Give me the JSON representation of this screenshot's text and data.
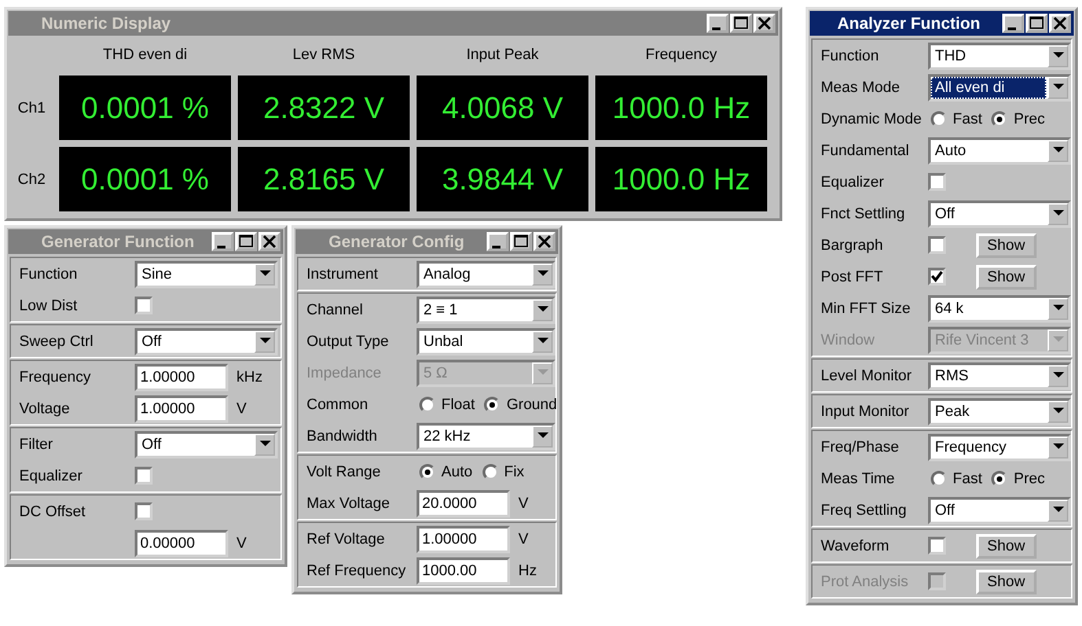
{
  "windows": [
    {
      "kind": "numeric",
      "title": "Numeric Display",
      "active": false,
      "columns": [
        "THD even di",
        "Lev RMS",
        "Input Peak",
        "Frequency"
      ],
      "rows": [
        {
          "label": "Ch1",
          "values": [
            "0.0001 %",
            "2.8322 V",
            "4.0068 V",
            "1000.0 Hz"
          ]
        },
        {
          "label": "Ch2",
          "values": [
            "0.0001 %",
            "2.8165 V",
            "3.9844 V",
            "1000.0 Hz"
          ]
        }
      ]
    },
    {
      "kind": "form",
      "title": "Generator Function",
      "active": false,
      "sections": [
        [
          {
            "kind": "select",
            "label": "Function",
            "value": "Sine",
            "disabled": false,
            "focused": false
          },
          {
            "kind": "check",
            "label": "Low Dist",
            "checked": false,
            "disabled": false
          }
        ],
        [
          {
            "kind": "select",
            "label": "Sweep Ctrl",
            "value": "Off",
            "disabled": false,
            "focused": false
          }
        ],
        [
          {
            "kind": "field",
            "label": "Frequency",
            "value": "1.00000",
            "unit": "kHz"
          },
          {
            "kind": "field",
            "label": "Voltage",
            "value": "1.00000",
            "unit": "V"
          }
        ],
        [
          {
            "kind": "select",
            "label": "Filter",
            "value": "Off",
            "disabled": false,
            "focused": false
          },
          {
            "kind": "check",
            "label": "Equalizer",
            "checked": false,
            "disabled": false
          }
        ],
        [
          {
            "kind": "check",
            "label": "DC Offset",
            "checked": false,
            "disabled": false
          },
          {
            "kind": "field",
            "value": "0.00000",
            "unit": "V"
          }
        ]
      ]
    },
    {
      "kind": "form",
      "title": "Generator Config",
      "active": false,
      "sections": [
        [
          {
            "kind": "select",
            "label": "Instrument",
            "value": "Analog",
            "disabled": false,
            "focused": false
          }
        ],
        [
          {
            "kind": "select",
            "label": "Channel",
            "value": "2 ≡ 1",
            "disabled": false,
            "focused": false
          },
          {
            "kind": "select",
            "label": "Output Type",
            "value": "Unbal",
            "disabled": false,
            "focused": false
          },
          {
            "kind": "select",
            "label": "Impedance",
            "value": "5 Ω",
            "disabled": true,
            "focused": false
          },
          {
            "kind": "radio",
            "label": "Common",
            "options": [
              {
                "label": "Float",
                "selected": false
              },
              {
                "label": "Ground",
                "selected": true
              }
            ]
          },
          {
            "kind": "select",
            "label": "Bandwidth",
            "value": "22 kHz",
            "disabled": false,
            "focused": false
          }
        ],
        [
          {
            "kind": "radio",
            "label": "Volt Range",
            "options": [
              {
                "label": "Auto",
                "selected": true
              },
              {
                "label": "Fix",
                "selected": false
              }
            ]
          },
          {
            "kind": "field",
            "label": "Max Voltage",
            "value": "20.0000",
            "unit": "V"
          }
        ],
        [
          {
            "kind": "field",
            "label": "Ref Voltage",
            "value": "1.00000",
            "unit": "V"
          },
          {
            "kind": "field",
            "label": "Ref Frequency",
            "value": "1000.00",
            "unit": "Hz"
          }
        ]
      ]
    },
    {
      "kind": "form",
      "title": "Analyzer Function",
      "active": true,
      "sections": [
        [
          {
            "kind": "select",
            "label": "Function",
            "value": "THD",
            "disabled": false,
            "focused": false
          },
          {
            "kind": "select",
            "label": "Meas Mode",
            "value": "All even di",
            "disabled": false,
            "focused": true
          },
          {
            "kind": "radio",
            "label": "Dynamic Mode",
            "options": [
              {
                "label": "Fast",
                "selected": false
              },
              {
                "label": "Prec",
                "selected": true
              }
            ]
          },
          {
            "kind": "select",
            "label": "Fundamental",
            "value": "Auto",
            "disabled": false,
            "focused": false
          },
          {
            "kind": "check",
            "label": "Equalizer",
            "checked": false,
            "disabled": false
          },
          {
            "kind": "select",
            "label": "Fnct Settling",
            "value": "Off",
            "disabled": false,
            "focused": false
          },
          {
            "kind": "check_button",
            "label": "Bargraph",
            "checked": false,
            "disabled": false,
            "button": "Show"
          },
          {
            "kind": "check_button",
            "label": "Post FFT",
            "checked": true,
            "disabled": false,
            "button": "Show"
          },
          {
            "kind": "select",
            "label": "Min FFT Size",
            "value": "64 k",
            "disabled": false,
            "focused": false
          },
          {
            "kind": "select",
            "label": "Window",
            "value": "Rife Vincent 3",
            "disabled": true,
            "focused": false
          }
        ],
        [
          {
            "kind": "select",
            "label": "Level Monitor",
            "value": "RMS",
            "disabled": false,
            "focused": false
          }
        ],
        [
          {
            "kind": "select",
            "label": "Input Monitor",
            "value": "Peak",
            "disabled": false,
            "focused": false
          }
        ],
        [
          {
            "kind": "select",
            "label": "Freq/Phase",
            "value": "Frequency",
            "disabled": false,
            "focused": false
          },
          {
            "kind": "radio",
            "label": "Meas Time",
            "options": [
              {
                "label": "Fast",
                "selected": false
              },
              {
                "label": "Prec",
                "selected": true
              }
            ]
          },
          {
            "kind": "select",
            "label": "Freq Settling",
            "value": "Off",
            "disabled": false,
            "focused": false
          }
        ],
        [
          {
            "kind": "check_button",
            "label": "Waveform",
            "checked": false,
            "disabled": false,
            "button": "Show"
          }
        ],
        [
          {
            "kind": "check_button",
            "label": "Prot Analysis",
            "checked": false,
            "disabled": true,
            "button": "Show"
          }
        ]
      ]
    }
  ]
}
